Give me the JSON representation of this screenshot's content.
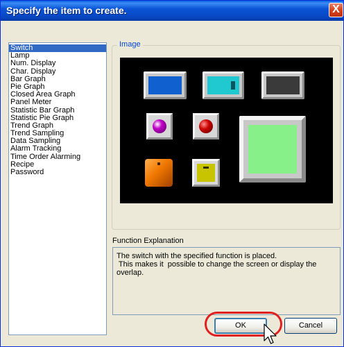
{
  "window": {
    "title": "Specify the item to create.",
    "close_glyph": "X"
  },
  "items": [
    {
      "label": "Switch",
      "selected": true
    },
    {
      "label": "Lamp"
    },
    {
      "label": "Num. Display"
    },
    {
      "label": "Char. Display"
    },
    {
      "label": "Bar Graph"
    },
    {
      "label": "Pie Graph"
    },
    {
      "label": "Closed Area Graph"
    },
    {
      "label": "Panel Meter"
    },
    {
      "label": "Statistic Bar Graph"
    },
    {
      "label": "Statistic Pie Graph"
    },
    {
      "label": "Trend Graph"
    },
    {
      "label": "Trend Sampling"
    },
    {
      "label": "Data Sampling"
    },
    {
      "label": "Alarm Tracking"
    },
    {
      "label": "Time Order Alarming"
    },
    {
      "label": "Recipe"
    },
    {
      "label": "Password"
    }
  ],
  "image_group": {
    "label": "Image",
    "swatches": {
      "blue": "#1160d0",
      "cyan": "#20c8d0",
      "dark": "#3a3a3a",
      "magenta": "#c000c8",
      "red": "#cc0000",
      "orange": "#f07800",
      "yellow": "#c8c400",
      "green": "#88f088"
    }
  },
  "explanation": {
    "label": "Function Explanation",
    "lines": [
      "The switch with the specified function is placed.",
      " This makes it  possible to change the screen or display the",
      "overlap."
    ]
  },
  "buttons": {
    "ok": "OK",
    "cancel": "Cancel"
  }
}
